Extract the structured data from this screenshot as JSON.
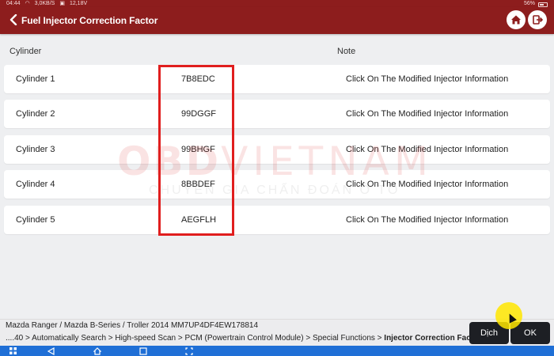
{
  "status_bar": {
    "time": "04:44",
    "network_speed": "3,0KB/S",
    "voltage": "12,18V",
    "battery": "56%"
  },
  "header": {
    "title": "Fuel Injector Correction Factor",
    "icons": {
      "back": "back-arrow-icon",
      "home": "home-icon",
      "exit": "exit-icon"
    }
  },
  "table": {
    "headers": {
      "cylinder": "Cylinder",
      "note": "Note"
    },
    "rows": [
      {
        "cylinder": "Cylinder 1",
        "code": "7B8EDC",
        "note": "Click On The Modified Injector Information"
      },
      {
        "cylinder": "Cylinder 2",
        "code": "99DGGF",
        "note": "Click On The Modified Injector Information"
      },
      {
        "cylinder": "Cylinder 3",
        "code": "99BHGF",
        "note": "Click On The Modified Injector Information"
      },
      {
        "cylinder": "Cylinder 4",
        "code": "8BBDEF",
        "note": "Click On The Modified Injector Information"
      },
      {
        "cylinder": "Cylinder 5",
        "code": "AEGFLH",
        "note": "Click On The Modified Injector Information"
      }
    ]
  },
  "watermark": {
    "brand": "OBD",
    "brand_right": "VIETNAM",
    "tagline": "CHUYÊN GIA CHẨN ĐOÁN Ô TÔ"
  },
  "footer": {
    "vehicle": "Mazda  Ranger / Mazda B-Series / Troller 2014   MM7UP4DF4EW178814",
    "breadcrumb_path": "....40 > Automatically Search > High-speed Scan > PCM (Powertrain Control Module) > Special Functions > ",
    "breadcrumb_current": "Injector Correction Factors",
    "translate_label": "Dịch",
    "ok_label": "OK"
  },
  "colors": {
    "header": "#8d1d1d",
    "highlight": "#e01e1e",
    "button": "#1d1f24",
    "nav": "#1f6fd6"
  }
}
